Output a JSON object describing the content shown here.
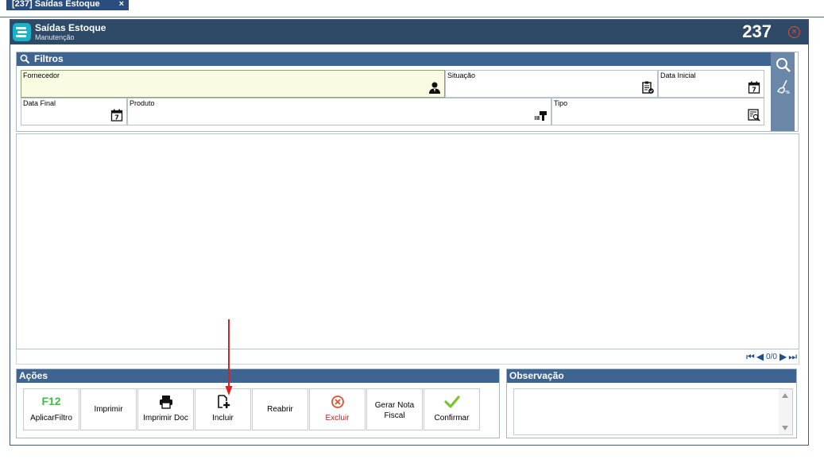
{
  "tab": {
    "label": "[237] Saídas Estoque",
    "close": "×"
  },
  "window": {
    "title": "Saídas Estoque",
    "subtitle": "Manutenção",
    "number": "237",
    "close_glyph": "×"
  },
  "filtros": {
    "title": "Filtros",
    "fields": {
      "fornecedor": {
        "label": "Fornecedor",
        "icon": "person-icon"
      },
      "situacao": {
        "label": "Situação",
        "icon": "clipboard-check-icon"
      },
      "data_inicial": {
        "label": "Data Inicial",
        "icon": "calendar-icon",
        "day": "7"
      },
      "data_final": {
        "label": "Data Final",
        "icon": "calendar-icon",
        "day": "7"
      },
      "produto": {
        "label": "Produto",
        "icon": "barcode-scanner-icon"
      },
      "tipo": {
        "label": "Tipo",
        "icon": "list-search-icon"
      }
    },
    "side": {
      "search_icon": "search-icon",
      "clear_icon": "broom-icon"
    }
  },
  "grid": {
    "pager": {
      "count": "0/0"
    }
  },
  "acoes": {
    "title": "Ações",
    "buttons": [
      {
        "key": "aplicar_filtro",
        "label": "AplicarFiltro",
        "icon": "f12-icon",
        "icon_text": "F12"
      },
      {
        "key": "imprimir",
        "label": "Imprimir"
      },
      {
        "key": "imprimir_doc",
        "label": "Imprimir Doc",
        "icon": "printer-icon"
      },
      {
        "key": "incluir",
        "label": "Incluir",
        "icon": "add-document-icon"
      },
      {
        "key": "reabrir",
        "label": "Reabrir"
      },
      {
        "key": "excluir",
        "label": "Excluir",
        "icon": "close-circle-icon"
      },
      {
        "key": "gerar_nota",
        "label": "Gerar Nota Fiscal"
      },
      {
        "key": "confirmar",
        "label": "Confirmar",
        "icon": "check-icon"
      }
    ]
  },
  "observacao": {
    "title": "Observação",
    "value": ""
  },
  "colors": {
    "header_blue": "#3e6591",
    "titlebar": "#2e4a66",
    "accent_teal": "#17b3c9",
    "danger": "#c81919",
    "success": "#7cc232",
    "annotation": "#e02020"
  }
}
